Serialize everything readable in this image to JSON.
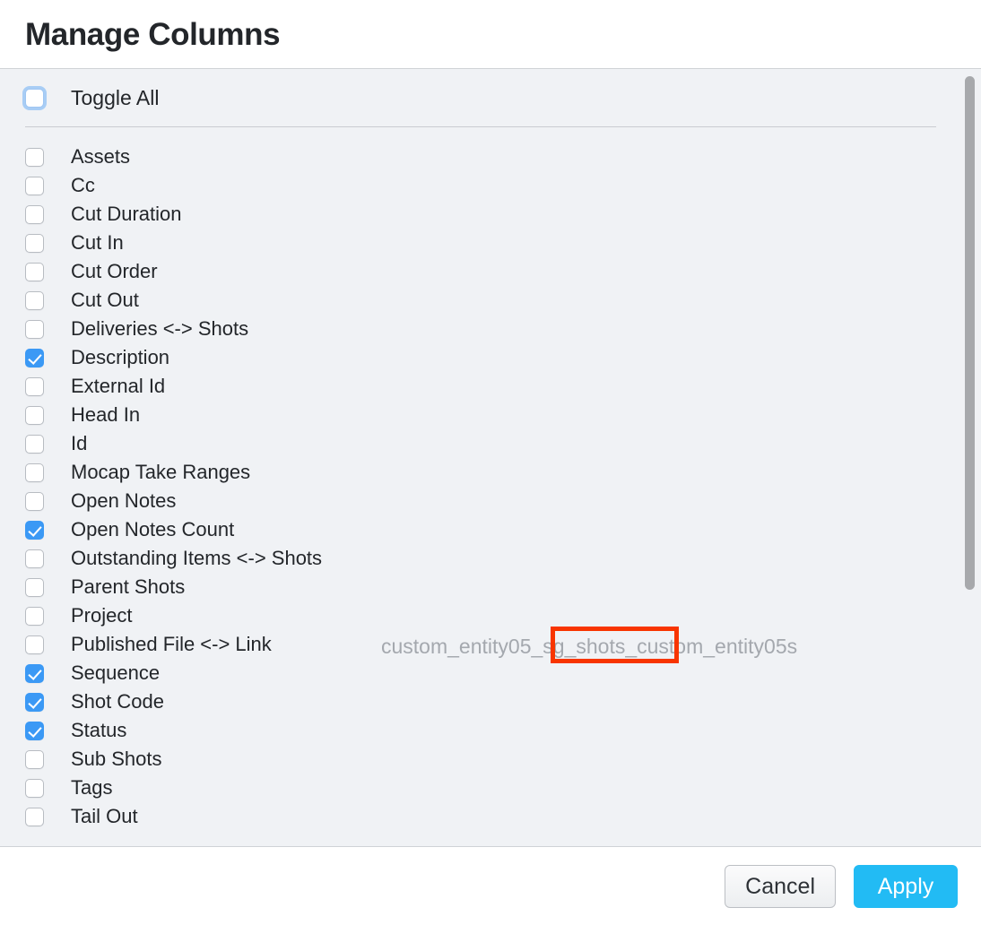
{
  "dialog": {
    "title": "Manage Columns"
  },
  "toggle_all": {
    "label": "Toggle All",
    "checked": false
  },
  "columns": [
    {
      "label": "Assets",
      "checked": false
    },
    {
      "label": "Cc",
      "checked": false
    },
    {
      "label": "Cut Duration",
      "checked": false
    },
    {
      "label": "Cut In",
      "checked": false
    },
    {
      "label": "Cut Order",
      "checked": false
    },
    {
      "label": "Cut Out",
      "checked": false
    },
    {
      "label": "Deliveries <-> Shots",
      "checked": false
    },
    {
      "label": "Description",
      "checked": true
    },
    {
      "label": "External Id",
      "checked": false
    },
    {
      "label": "Head In",
      "checked": false
    },
    {
      "label": "Id",
      "checked": false
    },
    {
      "label": "Mocap Take Ranges",
      "checked": false
    },
    {
      "label": "Open Notes",
      "checked": false
    },
    {
      "label": "Open Notes Count",
      "checked": true
    },
    {
      "label": "Outstanding Items <-> Shots",
      "checked": false
    },
    {
      "label": "Parent Shots",
      "checked": false
    },
    {
      "label": "Project",
      "checked": false
    },
    {
      "label": "Published File <-> Link",
      "checked": false
    },
    {
      "label": "Sequence",
      "checked": true
    },
    {
      "label": "Shot Code",
      "checked": true
    },
    {
      "label": "Status",
      "checked": true
    },
    {
      "label": "Sub Shots",
      "checked": false
    },
    {
      "label": "Tags",
      "checked": false
    },
    {
      "label": "Tail Out",
      "checked": false
    }
  ],
  "annotation": {
    "full_text": "custom_entity05_sg_shots_custom_entity05s",
    "prefix": "custom_entity05",
    "highlighted": "_sg_shots_",
    "suffix": "custom_entity05s",
    "highlight_color": "#f83500",
    "text_color": "#a4a8ae"
  },
  "footer": {
    "cancel_label": "Cancel",
    "apply_label": "Apply",
    "apply_color": "#22bbf4"
  },
  "scrollbar": {
    "thumb_color": "#a7a9ac"
  }
}
